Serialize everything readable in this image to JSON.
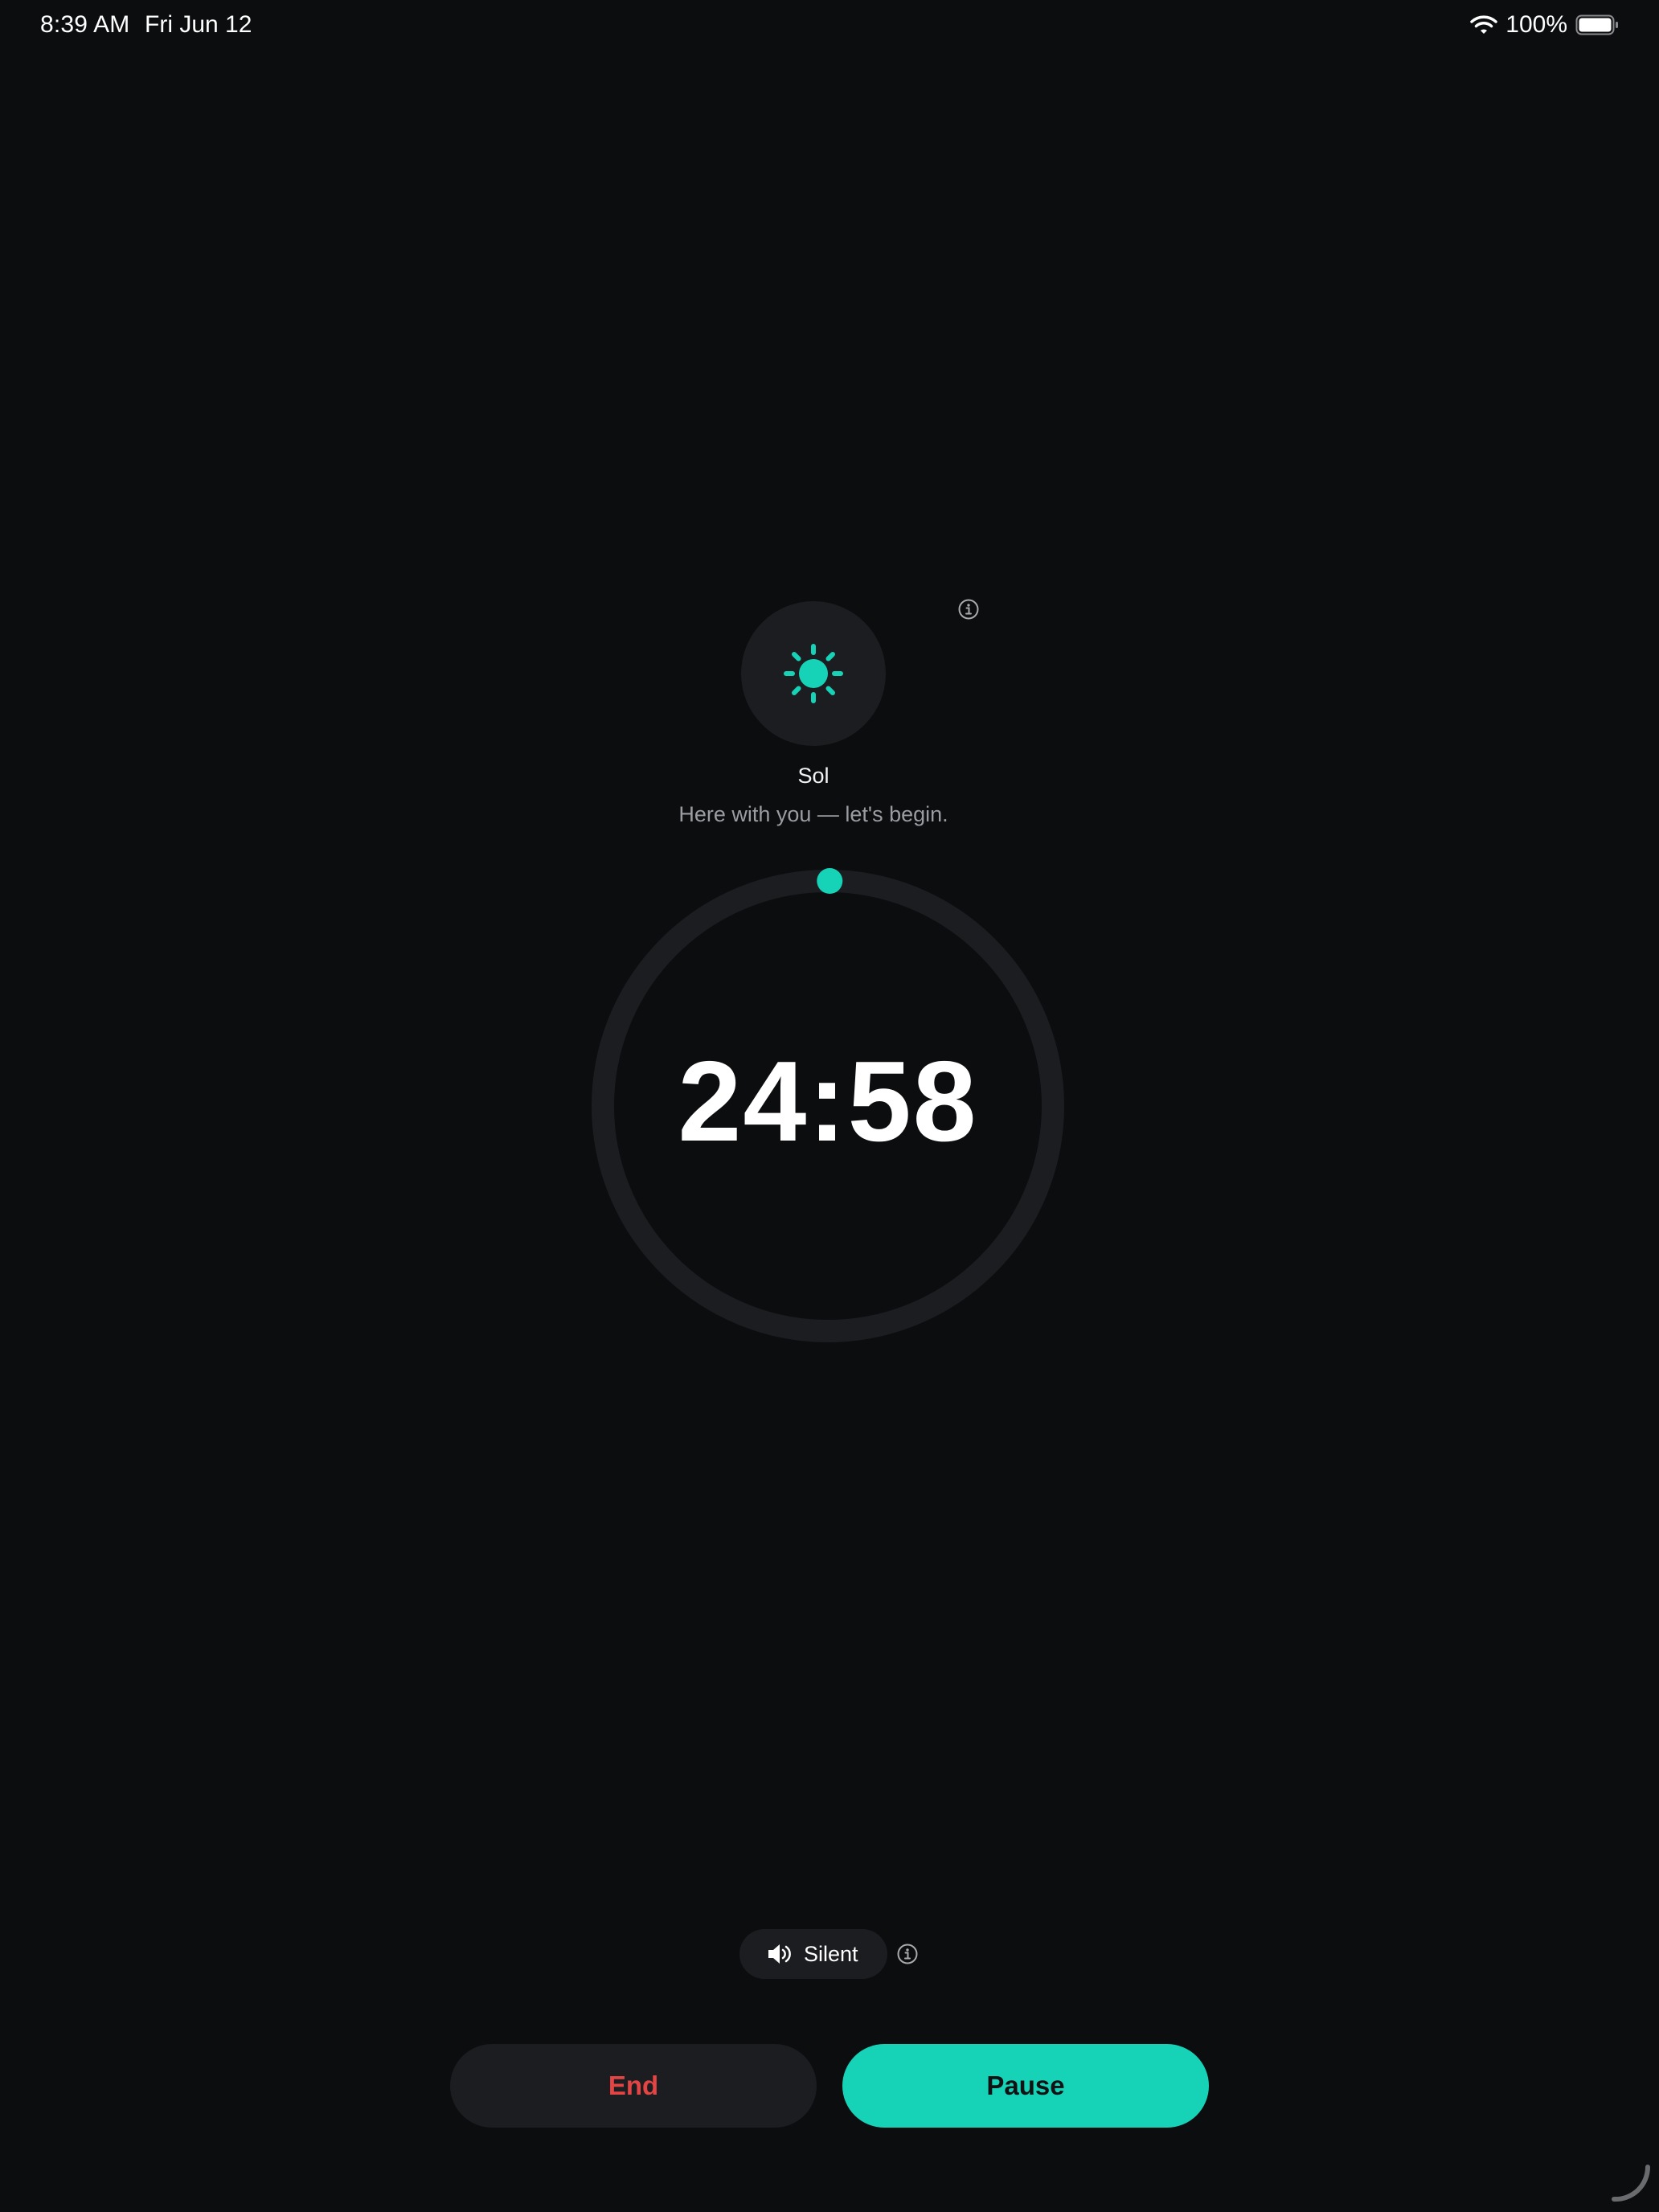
{
  "status_bar": {
    "time": "8:39 AM",
    "date": "Fri Jun 12",
    "battery": "100%"
  },
  "companion": {
    "icon": "sun-icon",
    "name": "Sol",
    "message": "Here with you — let's begin."
  },
  "timer": {
    "remaining": "24:58",
    "progress": 0.0013
  },
  "sound": {
    "icon": "speaker-icon",
    "label": "Silent"
  },
  "actions": {
    "end_label": "End",
    "pause_label": "Pause"
  },
  "colors": {
    "accent": "#16d3b8",
    "danger": "#e34545",
    "background": "#0c0d0f",
    "surface": "#1c1d21"
  }
}
